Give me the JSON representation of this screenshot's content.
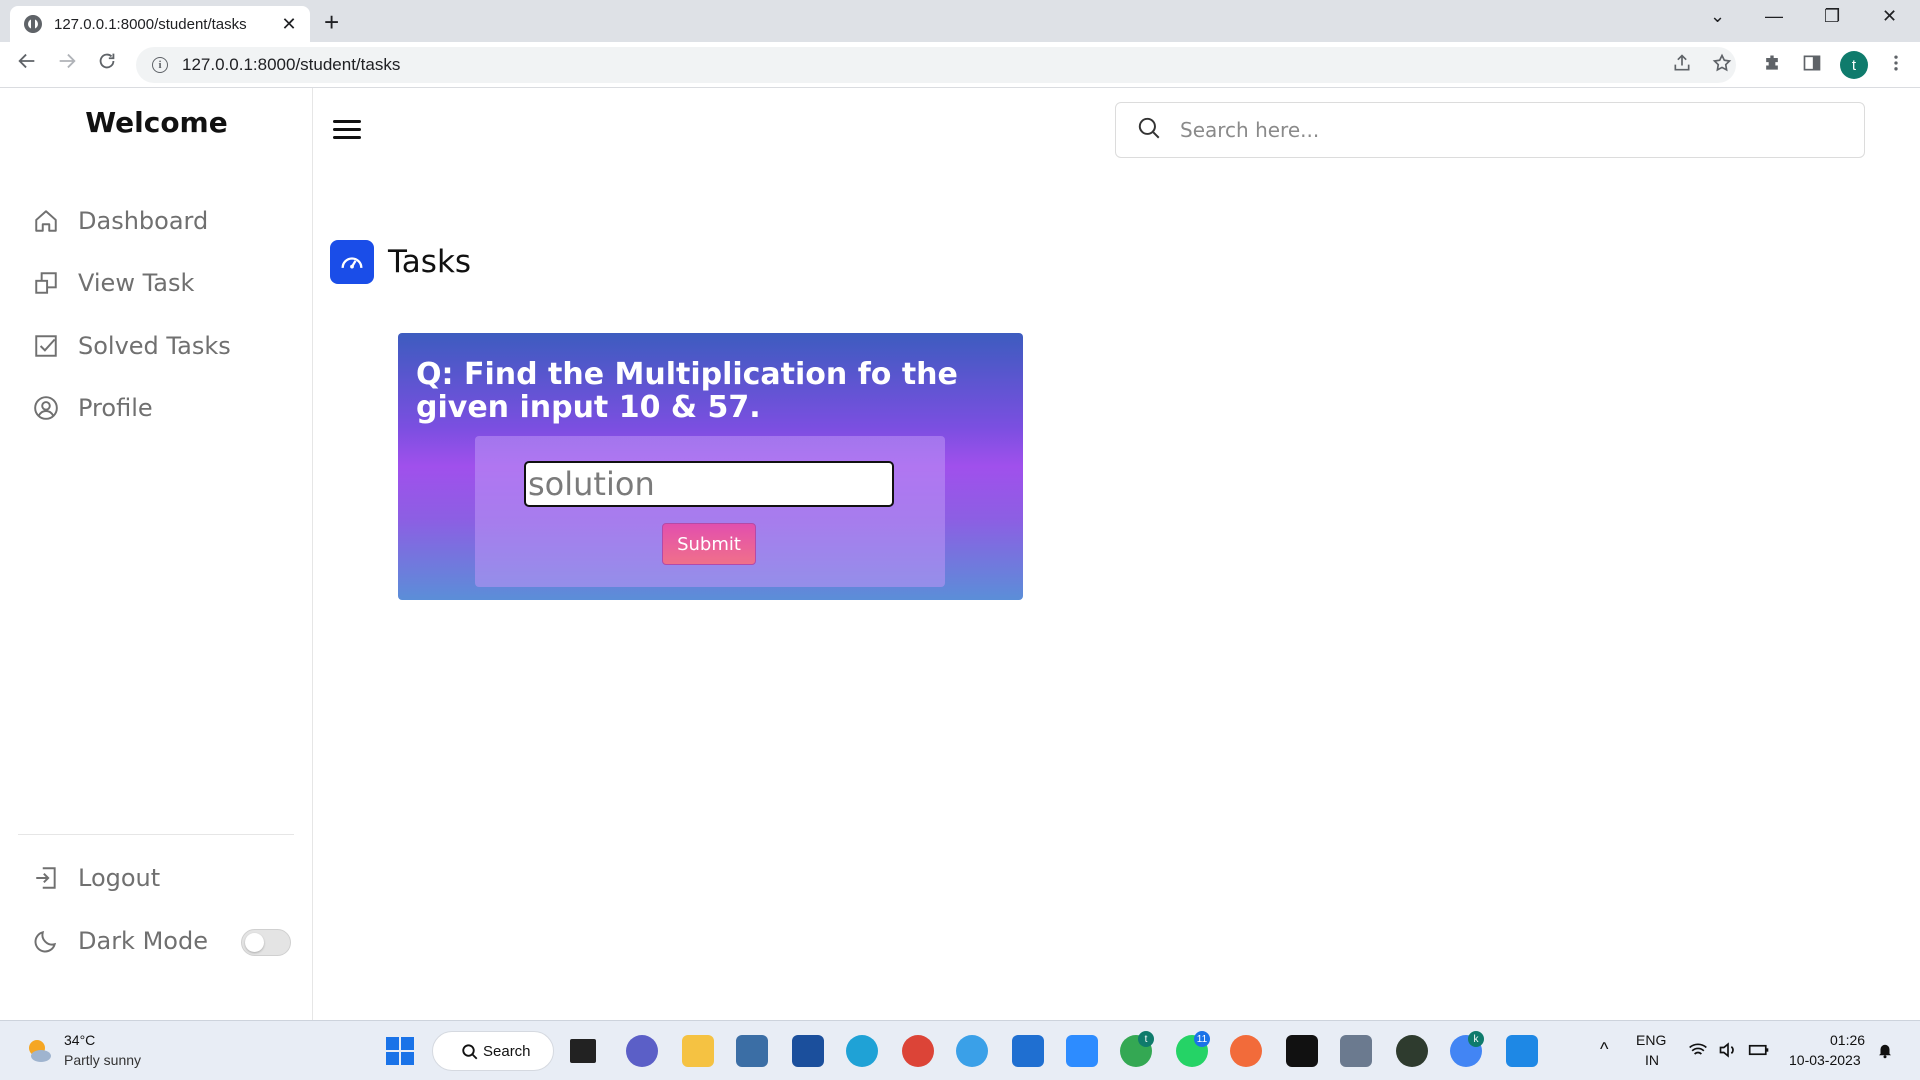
{
  "browser": {
    "tab_title": "127.0.0.1:8000/student/tasks",
    "tab_close": "✕",
    "new_tab": "+",
    "url": "127.0.0.1:8000/student/tasks",
    "profile_initial": "t",
    "window_controls": {
      "dropdown": "⌄",
      "minimize": "—",
      "restore": "❐",
      "close": "✕"
    }
  },
  "sidebar": {
    "brand": "Welcome",
    "items": [
      {
        "label": "Dashboard",
        "icon": "home-icon"
      },
      {
        "label": "View Task",
        "icon": "copy-icon"
      },
      {
        "label": "Solved Tasks",
        "icon": "check-square-icon"
      },
      {
        "label": "Profile",
        "icon": "user-circle-icon"
      }
    ],
    "logout_label": "Logout",
    "dark_mode_label": "Dark Mode",
    "dark_mode_on": false
  },
  "header": {
    "search_placeholder": "Search here..."
  },
  "main": {
    "page_title": "Tasks",
    "question": "Q: Find the Multiplication fo the given input 10 & 57.",
    "solution_placeholder": "solution",
    "submit_label": "Submit"
  },
  "taskbar": {
    "weather_temp": "34°C",
    "weather_desc": "Partly sunny",
    "search_label": "Search",
    "lang_top": "ENG",
    "lang_bottom": "IN",
    "time": "01:26",
    "date": "10-03-2023",
    "whatsapp_badge": "11",
    "chrome_badge": "t",
    "chrome2_badge": "k",
    "tray_chevron": "^"
  },
  "colors": {
    "accent_blue": "#1a4de8",
    "card_gradient_top": "#3d5cbf",
    "card_gradient_mid": "#a050ec",
    "submit_pink": "#e24fae"
  }
}
